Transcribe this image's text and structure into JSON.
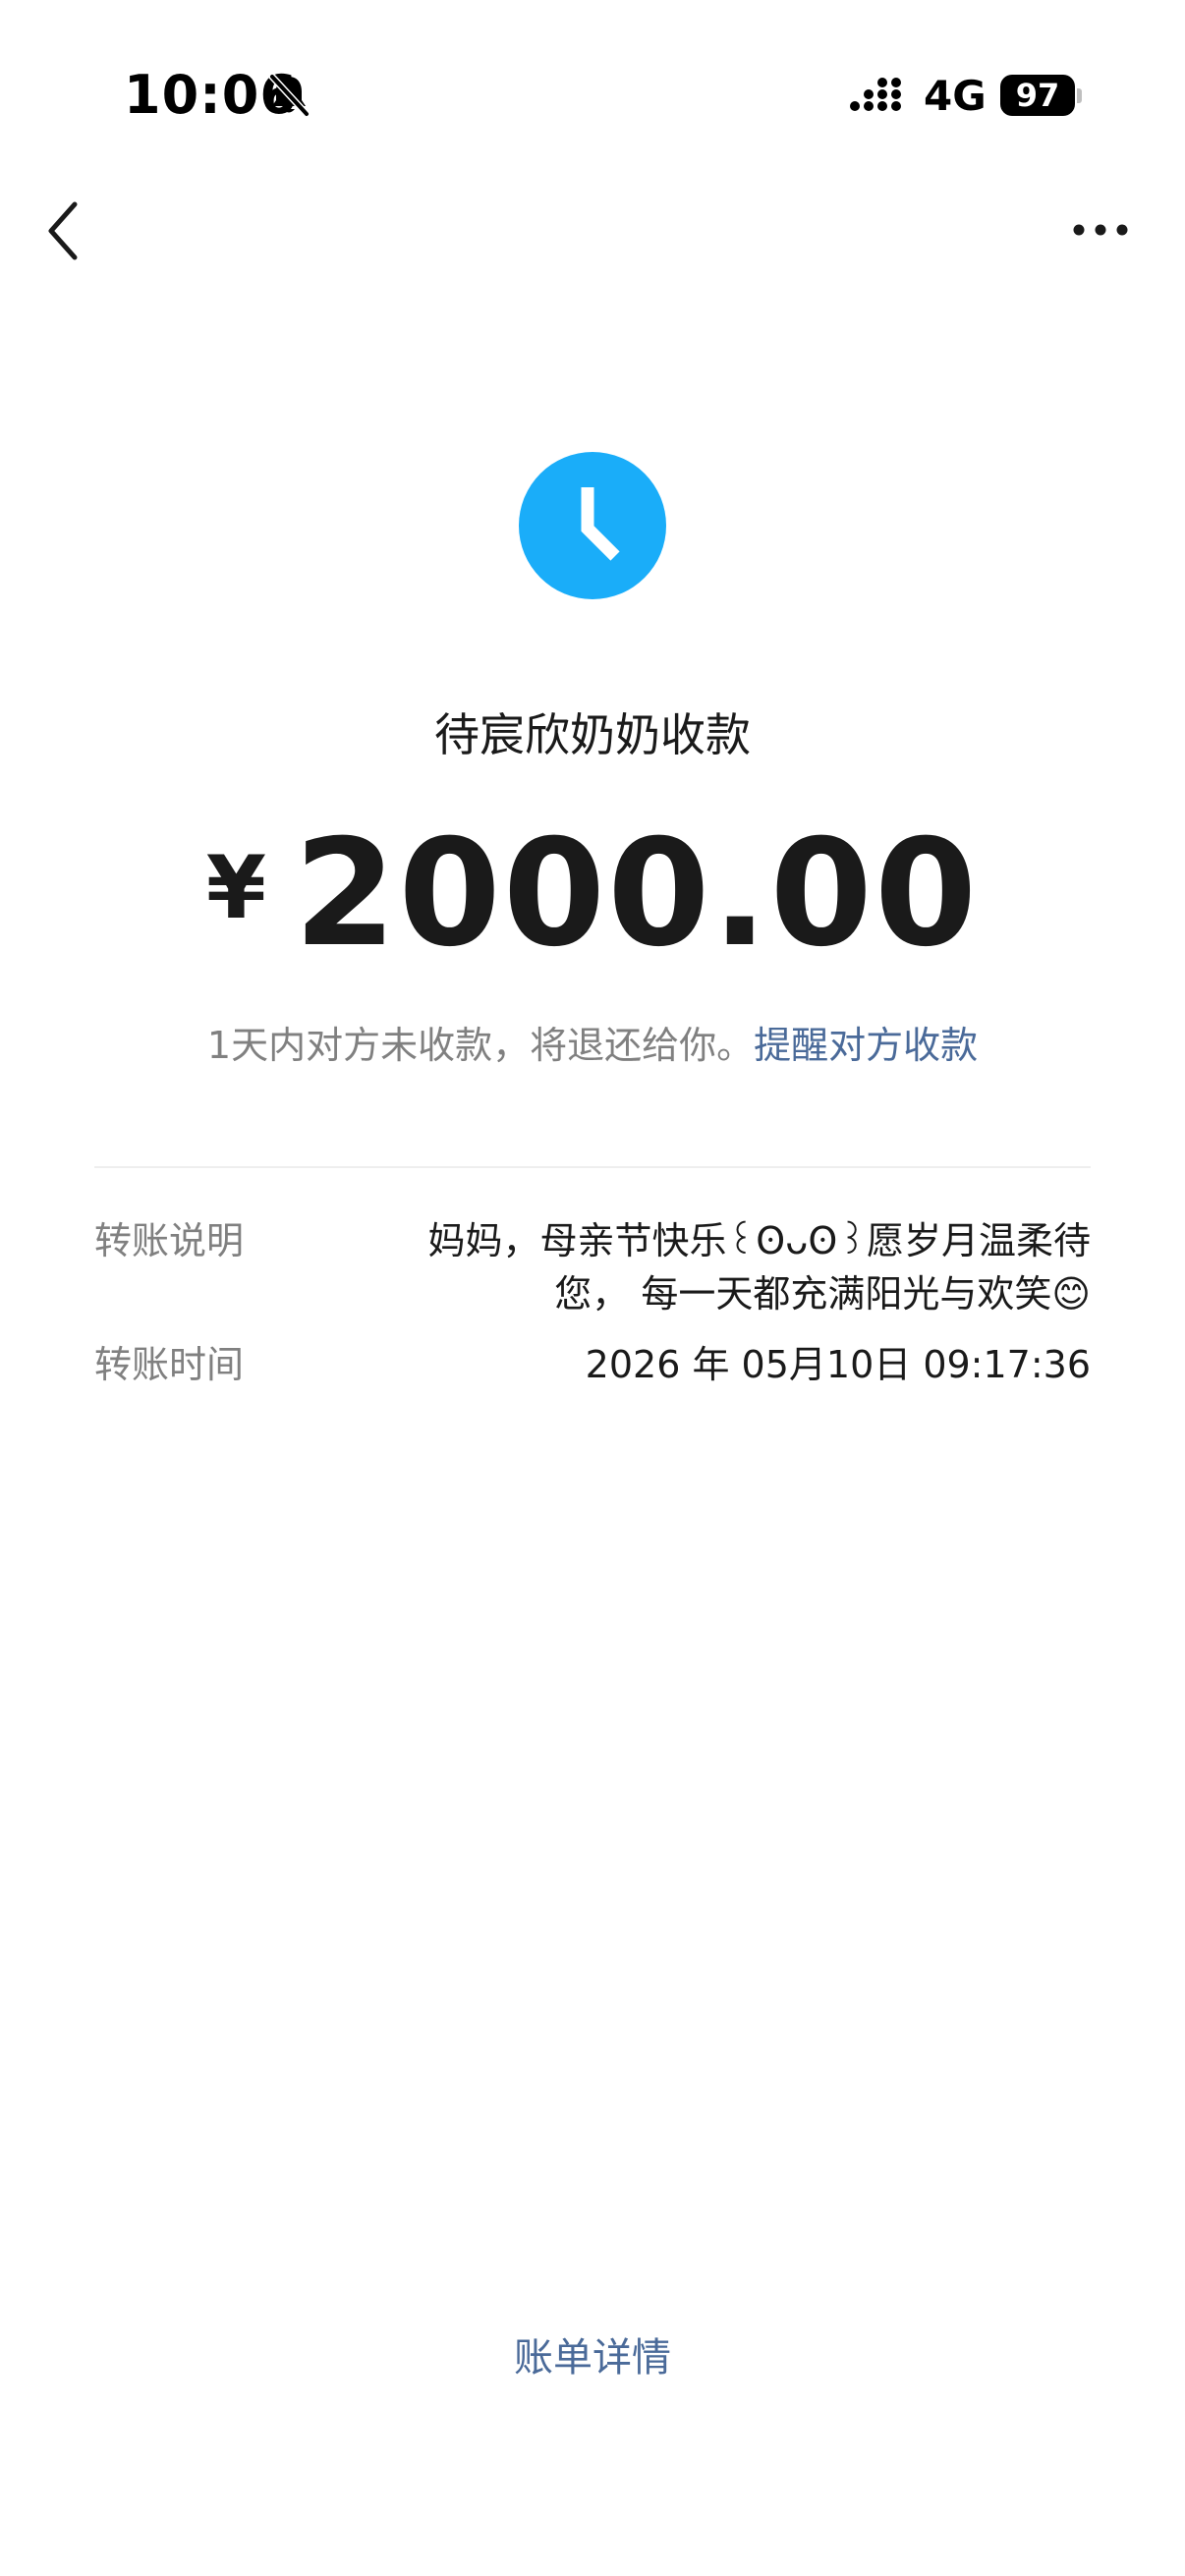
{
  "status_bar": {
    "time": "10:06",
    "network": "4G",
    "battery_level": "97"
  },
  "nav": {
    "back_icon": "chevron-left-icon",
    "more_icon": "more-dots-icon"
  },
  "status": {
    "icon": "clock-icon",
    "icon_color": "#1AADF9",
    "title": "待宸欣奶奶收款"
  },
  "amount": {
    "currency": "¥",
    "value": "2000.00"
  },
  "notice": {
    "text": "1天内对方未收款，将退还给你。",
    "remind_link": "提醒对方收款"
  },
  "details": {
    "note_label": "转账说明",
    "note_value": "妈妈，母亲节快乐꒰ʘᴗʘ꒱愿岁月温柔待您， 每一天都充满阳光与欢笑😊",
    "time_label": "转账时间",
    "time_value": "2026 年 05月10日 09:17:36"
  },
  "footer": {
    "bill_detail_link": "账单详情"
  },
  "colors": {
    "link": "#4A6A99",
    "muted_text": "#808080",
    "primary_text": "#1A1A1A",
    "accent_clock": "#1AADF9"
  }
}
